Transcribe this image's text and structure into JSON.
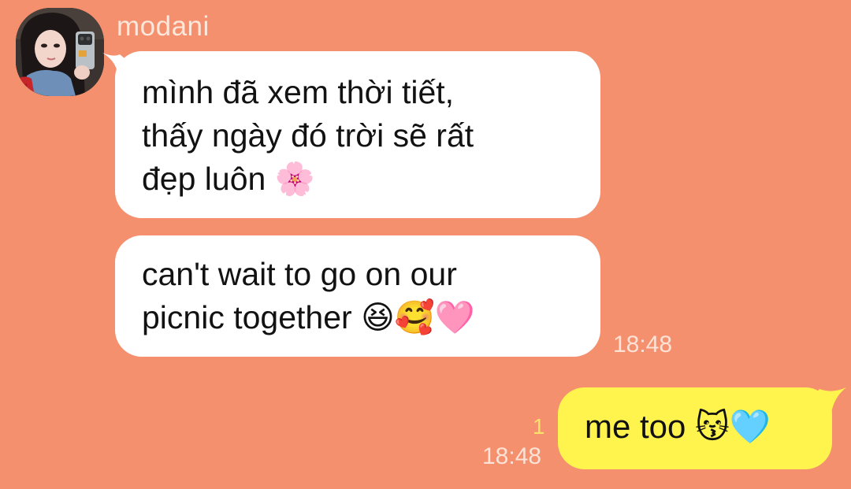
{
  "incoming": {
    "sender": "modani",
    "messages": [
      {
        "lines": [
          "mình đã xem thời tiết,",
          "thấy ngày đó trời sẽ rất",
          "đẹp luôn"
        ],
        "emoji": "🌸"
      },
      {
        "lines": [
          "can't wait to go on our",
          "picnic together"
        ],
        "emoji": "😆🥰🩷"
      }
    ],
    "time": "18:48"
  },
  "outgoing": {
    "text": "me too",
    "emoji": "😽🩵",
    "time": "18:48",
    "unread_count": "1"
  },
  "colors": {
    "background": "#f4906e",
    "incoming_bubble": "#ffffff",
    "outgoing_bubble": "#fff34d",
    "sender_name": "#fde6da",
    "timestamp": "#fde2d6",
    "unread_count": "#f7e36a"
  },
  "icons": {
    "avatar": "profile-photo"
  }
}
